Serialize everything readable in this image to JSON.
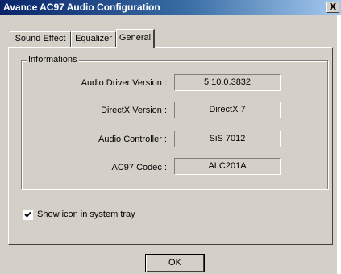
{
  "window": {
    "title": "Avance AC97 Audio Configuration",
    "close_label": "X"
  },
  "tabs": [
    {
      "label": "Sound Effect",
      "active": false
    },
    {
      "label": "Equalizer",
      "active": false
    },
    {
      "label": "General",
      "active": true
    }
  ],
  "general": {
    "group_title": "Informations",
    "fields": [
      {
        "label": "Audio Driver Version :",
        "value": "5.10.0.3832"
      },
      {
        "label": "DirectX Version :",
        "value": "DirectX 7"
      },
      {
        "label": "Audio Controller :",
        "value": "SiS 7012"
      },
      {
        "label": "AC97 Codec :",
        "value": "ALC201A"
      }
    ],
    "tray_checkbox": {
      "label": "Show icon in system tray",
      "checked": true
    }
  },
  "buttons": {
    "ok_label": "OK"
  }
}
